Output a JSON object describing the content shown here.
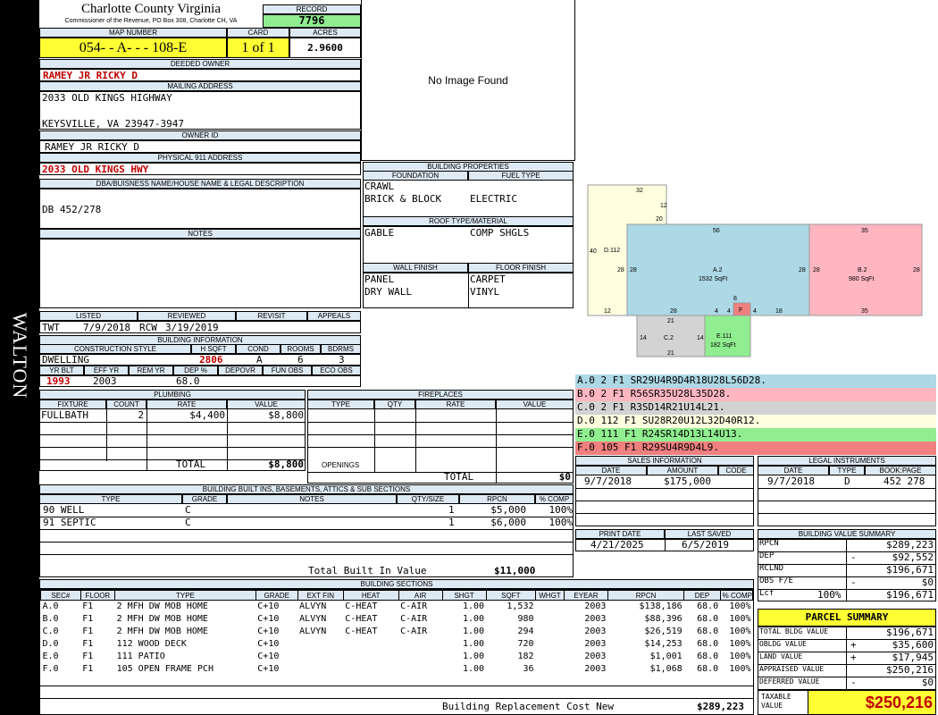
{
  "sidebar_name": "WALTON",
  "header": {
    "county": "Charlotte County Virginia",
    "office": "Commissioner of the Revenue, PO Box 308, Charlotte CH, VA",
    "record_label": "RECORD",
    "record": "7796",
    "map_number_label": "MAP NUMBER",
    "map_number": "054- - A- - - 108-E",
    "card_label": "CARD",
    "card": "1 of 1",
    "acres_label": "ACRES",
    "acres": "2.9600"
  },
  "owner": {
    "deeded_owner_label": "DEEDED OWNER",
    "deeded_owner": "RAMEY JR RICKY D",
    "mailing_label": "MAILING ADDRESS",
    "mailing_line1": "2033 OLD KINGS HIGHWAY",
    "mailing_line2": "KEYSVILLE, VA 23947-3947",
    "owner_id_label": "OWNER ID",
    "owner_id": "RAMEY JR RICKY D",
    "physical_label": "PHYSICAL 911 ADDRESS",
    "physical": "2033 OLD KINGS  HWY",
    "dba_label": "DBA/BUISNESS NAME/HOUSE NAME & LEGAL DESCRIPTION",
    "dba": "DB 452/278",
    "notes_label": "NOTES"
  },
  "photo": {
    "no_image": "No Image Found"
  },
  "review": {
    "labels": [
      "LISTED",
      "REVIEWED",
      "REVISIT",
      "APPEALS"
    ],
    "listed_by": "TWT",
    "listed_date": "7/9/2018",
    "reviewed_by": "RCW",
    "reviewed_date": "3/19/2019"
  },
  "building_info": {
    "title": "BUILDING INFORMATION",
    "construction_label": "CONSTRUCTION STYLE",
    "hsqft_label": "H SQFT",
    "cond_label": "COND",
    "rooms_label": "ROOMS",
    "bdrms_label": "BDRMS",
    "construction": "DWELLING",
    "hsqft": "2806",
    "cond": "A",
    "rooms": "6",
    "bdrms": "3",
    "yrblt_label": "YR BLT",
    "effyr_label": "EFF YR",
    "remyr_label": "REM YR",
    "dep_label": "DEP %",
    "depovr_label": "DEPOVR",
    "funobs_label": "FUN OBS",
    "ecoobs_label": "ECO OBS",
    "yrblt": "1993",
    "effyr": "2003",
    "dep": "68.0"
  },
  "building_properties": {
    "title": "BUILDING PROPERTIES",
    "foundation_label": "FOUNDATION",
    "fuel_label": "FUEL TYPE",
    "foundation": [
      "CRAWL",
      "BRICK & BLOCK"
    ],
    "fuel": "ELECTRIC",
    "roof_label": "ROOF TYPE/MATERIAL",
    "roof_type": "GABLE",
    "roof_material": "COMP SHGLS",
    "wall_label": "WALL FINISH",
    "floor_label": "FLOOR FINISH",
    "wall": [
      "PANEL",
      "DRY WALL"
    ],
    "floor": [
      "CARPET",
      "VINYL"
    ]
  },
  "sketch": {
    "labels": {
      "d_top": "32",
      "d_12": "12",
      "d_20": "20",
      "d_40": "40",
      "d_name": "D.112",
      "d_28": "28",
      "d_bot12": "12",
      "a_top": "56",
      "a_name": "A.2",
      "a_sqft": "1532 SqFt",
      "a_left": "28",
      "a_right": "28",
      "a_bot28": "28",
      "a_bot4": "4",
      "a_bot18": "18",
      "b_top": "35",
      "b_name": "B.2",
      "b_sqft": "980 SqFt",
      "b_left": "28",
      "b_right": "28",
      "b_bot": "35",
      "f_top": "8",
      "f_name": "F",
      "f_left": "4",
      "f_right": "4",
      "c_top": "21",
      "c_name": "C.2",
      "c_left": "14",
      "c_right": "14",
      "c_bot": "21",
      "e_name": "E.111",
      "e_sqft": "182 SqFt"
    },
    "colors": {
      "a": "#add8e6",
      "b": "#ffb6c1",
      "c": "#d3d3d3",
      "d": "#ffffe0",
      "e": "#90ee90",
      "f": "#f08080"
    }
  },
  "sections_vector": [
    {
      "text": "A.0   2    F1   SR29U4R9D4R18U28L56D28.",
      "color": "#add8e6"
    },
    {
      "text": "B.0   2    F1   R56SR35U28L35D28.",
      "color": "#ffb6c1"
    },
    {
      "text": "C.0   2    F1   R3SD14R21U14L21.",
      "color": "#d3d3d3"
    },
    {
      "text": "D.0   112  F1   SU28R20U12L32D40R12.",
      "color": "#ffffe0"
    },
    {
      "text": "E.0   111  F1   R24SR14D13L14U13.",
      "color": "#90ee90"
    },
    {
      "text": "F.0   105  F1   R29SU4R9D4L9.",
      "color": "#f08080"
    }
  ],
  "plumbing": {
    "title": "PLUMBING",
    "headers": [
      "FIXTURE",
      "COUNT",
      "RATE",
      "VALUE"
    ],
    "rows": [
      {
        "fixture": "FULLBATH",
        "count": "2",
        "rate": "$4,400",
        "value": "$8,800"
      }
    ],
    "total_label": "TOTAL",
    "total": "$8,800"
  },
  "fireplaces": {
    "title": "FIREPLACES",
    "headers": [
      "TYPE",
      "QTY",
      "RATE",
      "VALUE"
    ],
    "openings_label": "OPENINGS",
    "total_label": "TOTAL",
    "total": "$0"
  },
  "builtins": {
    "title": "BUILDING BUILT INS, BASEMENTS, ATTICS & SUB SECTIONS",
    "headers": [
      "TYPE",
      "GRADE",
      "NOTES",
      "QTY/SIZE",
      "RPCN",
      "% COMP"
    ],
    "rows": [
      {
        "type": "90 WELL",
        "grade": "C",
        "notes": "",
        "qty": "1",
        "rpcn": "$5,000",
        "comp": "100%"
      },
      {
        "type": "91 SEPTIC",
        "grade": "C",
        "notes": "",
        "qty": "1",
        "rpcn": "$6,000",
        "comp": "100%"
      }
    ],
    "total_label": "Total Built In Value",
    "total": "$11,000"
  },
  "sales": {
    "title": "SALES INFORMATION",
    "headers": [
      "DATE",
      "AMOUNT",
      "CODE"
    ],
    "rows": [
      {
        "date": "9/7/2018",
        "amount": "$175,000",
        "code": ""
      }
    ]
  },
  "legal": {
    "title": "LEGAL INSTRUMENTS",
    "headers": [
      "DATE",
      "TYPE",
      "BOOK:PAGE"
    ],
    "rows": [
      {
        "date": "9/7/2018",
        "type": "D",
        "book": "452 278"
      }
    ]
  },
  "dates": {
    "print_label": "PRINT DATE",
    "print": "4/21/2025",
    "saved_label": "LAST SAVED",
    "saved": "6/5/2019"
  },
  "value_summary": {
    "title": "BUILDING VALUE SUMMARY",
    "rows": [
      {
        "label": "RPCN",
        "sign": "",
        "value": "$289,223"
      },
      {
        "label": "DEP",
        "sign": "-",
        "value": "$92,552"
      },
      {
        "label": "RCLND",
        "sign": "",
        "value": "$196,671"
      },
      {
        "label": "OBS F/E",
        "sign": "-",
        "value": "$0"
      },
      {
        "label": "Lcf",
        "pct": "100%",
        "sign": "",
        "value": "$196,671"
      }
    ]
  },
  "parcel_summary": {
    "title": "PARCEL SUMMARY",
    "rows": [
      {
        "label": "TOTAL BLDG VALUE",
        "sign": "",
        "value": "$196,671"
      },
      {
        "label": "OBLDG VALUE",
        "sign": "+",
        "value": "$35,600"
      },
      {
        "label": "LAND VALUE",
        "sign": "+",
        "value": "$17,945"
      },
      {
        "label": "APPRAISED VALUE",
        "sign": "",
        "value": "$250,216"
      },
      {
        "label": "DEFERRED VALUE",
        "sign": "-",
        "value": "$0"
      }
    ],
    "taxable_label": "TAXABLE VALUE",
    "taxable": "$250,216"
  },
  "sections": {
    "title": "BUILDING SECTIONS",
    "headers": [
      "SEC#",
      "FLOOR",
      "TYPE",
      "GRADE",
      "EXT FIN",
      "HEAT",
      "AIR",
      "SHGT",
      "SQFT",
      "WHGT",
      "EYEAR",
      "RPCN",
      "DEP",
      "% COMP"
    ],
    "rows": [
      [
        "A.0",
        "F1",
        "2 MFH DW MOB HOME",
        "C+10",
        "ALVYN",
        "C-HEAT",
        "C-AIR",
        "1.00",
        "1,532",
        "",
        "2003",
        "$138,186",
        "68.0",
        "100%"
      ],
      [
        "B.0",
        "F1",
        "2 MFH DW MOB HOME",
        "C+10",
        "ALVYN",
        "C-HEAT",
        "C-AIR",
        "1.00",
        "980",
        "",
        "2003",
        "$88,396",
        "68.0",
        "100%"
      ],
      [
        "C.0",
        "F1",
        "2 MFH DW MOB HOME",
        "C+10",
        "ALVYN",
        "C-HEAT",
        "C-AIR",
        "1.00",
        "294",
        "",
        "2003",
        "$26,519",
        "68.0",
        "100%"
      ],
      [
        "D.0",
        "F1",
        "112 WOOD DECK",
        "C+10",
        "",
        "",
        "",
        "1.00",
        "720",
        "",
        "2003",
        "$14,253",
        "68.0",
        "100%"
      ],
      [
        "E.0",
        "F1",
        "111 PATIO",
        "C+10",
        "",
        "",
        "",
        "1.00",
        "182",
        "",
        "2003",
        "$1,001",
        "68.0",
        "100%"
      ],
      [
        "F.0",
        "F1",
        "105 OPEN FRAME PCH",
        "C+10",
        "",
        "",
        "",
        "1.00",
        "36",
        "",
        "2003",
        "$1,068",
        "68.0",
        "100%"
      ]
    ],
    "total_label": "Building Replacement Cost New",
    "total": "$289,223"
  }
}
